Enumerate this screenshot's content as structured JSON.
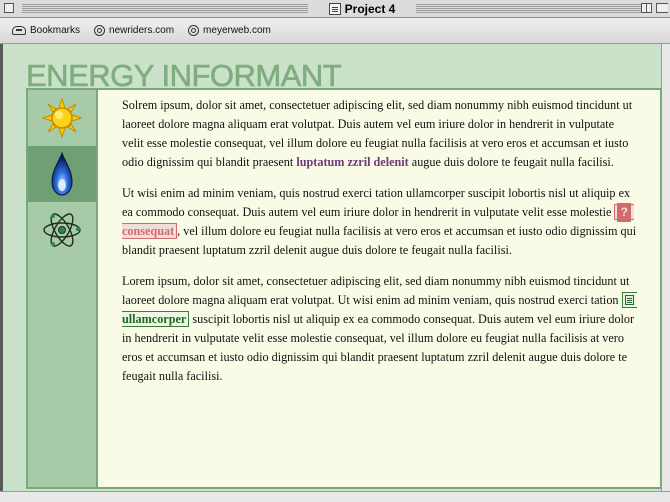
{
  "window": {
    "title": "Project 4"
  },
  "toolbar": {
    "bookmarks_label": "Bookmarks",
    "links": [
      "newriders.com",
      "meyerweb.com"
    ]
  },
  "site": {
    "title": "ENERGY INFORMANT",
    "colors": {
      "title": "#7eae7e",
      "page_background": "#c9e2c9",
      "content_background": "#fafbe6",
      "sidebar": "#a6cba6",
      "sidebar_active": "#6f9f74",
      "visited_link": "#6b3a7a",
      "flagged_link": "#d06c6c",
      "ok_link": "#1e6a1e"
    }
  },
  "sidebar": {
    "icons": [
      "sun-icon",
      "flame-icon",
      "atom-icon"
    ],
    "active_index": 1
  },
  "article": {
    "p1": {
      "text": "Solrem ipsum, dolor sit amet, consectetuer adipiscing elit, sed diam nonummy nibh euismod tincidunt ut laoreet dolore magna aliquam erat volutpat. Duis autem vel eum iriure dolor in hendrerit in vulputate velit esse molestie consequat, vel illum dolore eu feugiat nulla facilisis at vero eros et accumsan et iusto odio dignissim qui blandit praesent ",
      "link": "luptatum zzril delenit",
      "after": " augue duis dolore te feugait nulla facilisi."
    },
    "p2": {
      "before": "Ut wisi enim ad minim veniam, quis nostrud exerci tation ullamcorper suscipit lobortis nisl ut aliquip ex ea commodo consequat. Duis autem vel eum iriure dolor in hendrerit in vulputate velit esse molestie ",
      "link_marker": "?",
      "link": "consequat",
      "after": ", vel illum dolore eu feugiat nulla facilisis at vero eros et accumsan et iusto odio dignissim qui blandit praesent luptatum zzril delenit augue duis dolore te feugait nulla facilisi."
    },
    "p3": {
      "before": "Lorem ipsum, dolor sit amet, consectetuer adipiscing elit, sed diam nonummy nibh euismod tincidunt ut laoreet dolore magna aliquam erat volutpat. Ut wisi enim ad minim veniam, quis nostrud exerci tation ",
      "link": "ullamcorper",
      "after": " suscipit lobortis nisl ut aliquip ex ea commodo consequat. Duis autem vel eum iriure dolor in hendrerit in vulputate velit esse molestie consequat, vel illum dolore eu feugiat nulla facilisis at vero eros et accumsan et iusto odio dignissim qui blandit praesent luptatum zzril delenit augue duis dolore te feugait nulla facilisi."
    }
  }
}
